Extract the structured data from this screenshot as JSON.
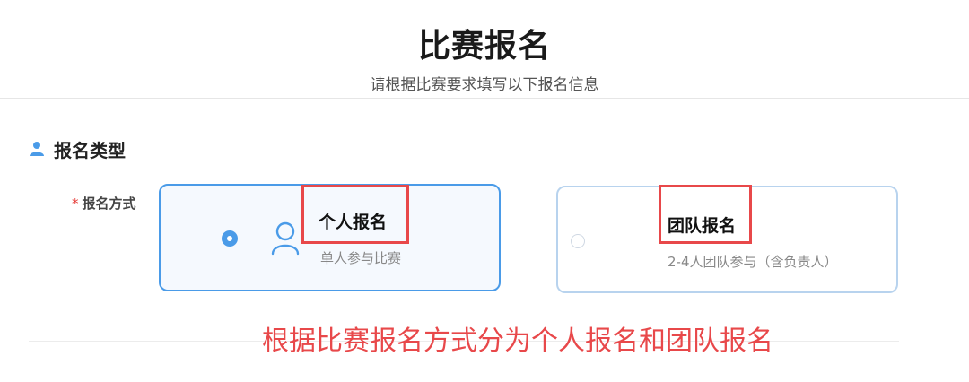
{
  "header": {
    "title": "比赛报名",
    "subtitle": "请根据比赛要求填写以下报名信息"
  },
  "section": {
    "icon": "user-icon",
    "title": "报名类型"
  },
  "form": {
    "field_label": "报名方式",
    "required_mark": "*",
    "options": [
      {
        "title": "个人报名",
        "desc": "单人参与比赛",
        "selected": true,
        "icon": "user-icon"
      },
      {
        "title": "团队报名",
        "desc": "2-4人团队参与（含负责人）",
        "selected": false
      }
    ]
  },
  "annotation": {
    "text": "根据比赛报名方式分为个人报名和团队报名",
    "color": "#e8484a"
  },
  "colors": {
    "accent": "#4a9be8",
    "highlight": "#e8484a"
  }
}
